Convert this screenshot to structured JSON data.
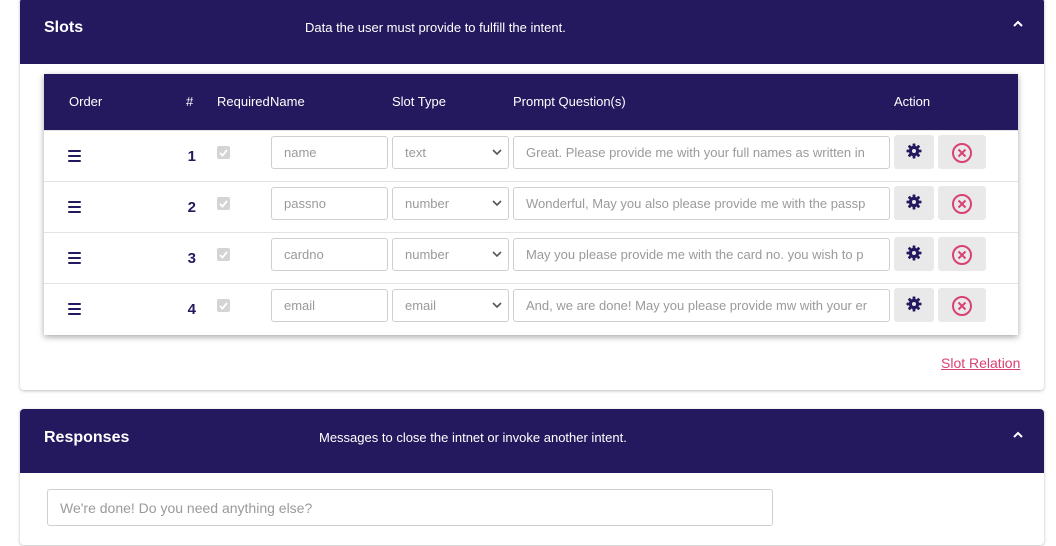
{
  "slots_panel": {
    "title": "Slots",
    "description": "Data the user must provide to fulfill the intent.",
    "collapse_icon": "chevron-up-icon"
  },
  "table": {
    "headers": {
      "order": "Order",
      "index": "#",
      "required": "Required",
      "name": "Name",
      "slot_type": "Slot Type",
      "prompt": "Prompt Question(s)",
      "action": "Action"
    },
    "rows": [
      {
        "index": "1",
        "required": true,
        "name": "name",
        "slot_type": "text",
        "prompt": "Great. Please provide me with your full names as written in"
      },
      {
        "index": "2",
        "required": true,
        "name": "passno",
        "slot_type": "number",
        "prompt": "Wonderful, May you also please provide me with the passp"
      },
      {
        "index": "3",
        "required": true,
        "name": "cardno",
        "slot_type": "number",
        "prompt": "May you please provide me with the card no. you wish to p"
      },
      {
        "index": "4",
        "required": true,
        "name": "email",
        "slot_type": "email",
        "prompt": "And, we are done! May you please provide mw with your er"
      }
    ]
  },
  "slot_relation_link": "Slot Relation",
  "responses_panel": {
    "title": "Responses",
    "description": "Messages to close the intnet or invoke another intent.",
    "collapse_icon": "chevron-up-icon",
    "input_placeholder": "We're done! Do you need anything else?"
  },
  "colors": {
    "header_bg": "#24195e",
    "link": "#d84272",
    "delete_icon": "#d84272"
  }
}
